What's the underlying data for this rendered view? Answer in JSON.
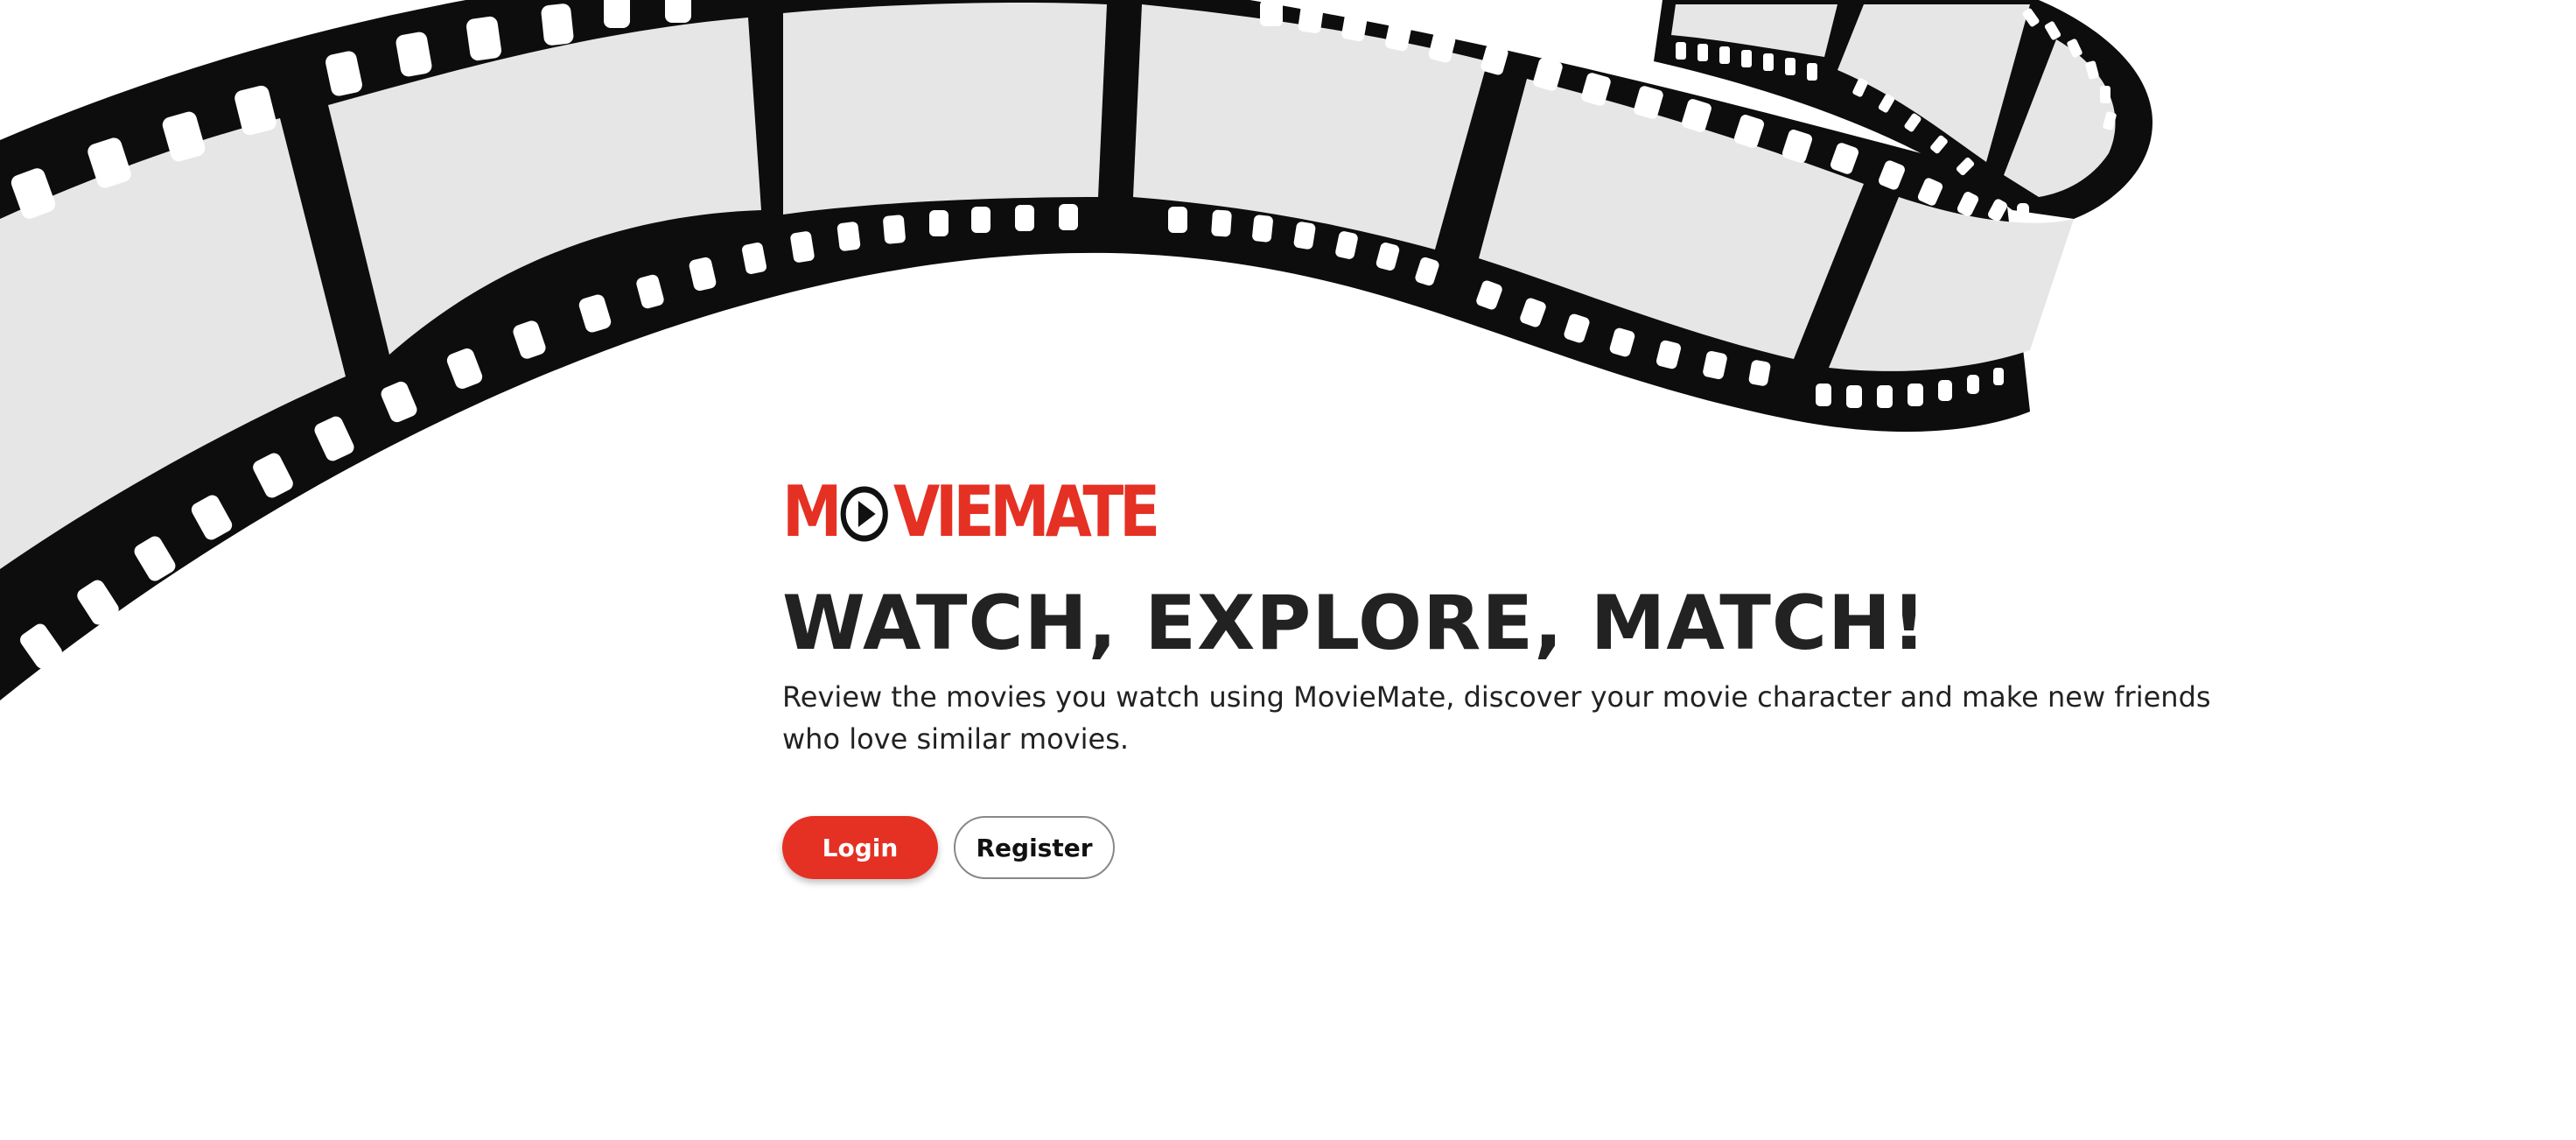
{
  "brand": {
    "logo_prefix": "M",
    "logo_suffix": "VIEMATE",
    "color": "#e53024"
  },
  "hero": {
    "headline": "WATCH, EXPLORE, MATCH!",
    "subtitle": "Review the movies you watch using MovieMate, discover your movie character and make new friends who love similar movies."
  },
  "actions": {
    "login_label": "Login",
    "register_label": "Register"
  },
  "decoration": {
    "film_strip_icon": "film-strip"
  }
}
